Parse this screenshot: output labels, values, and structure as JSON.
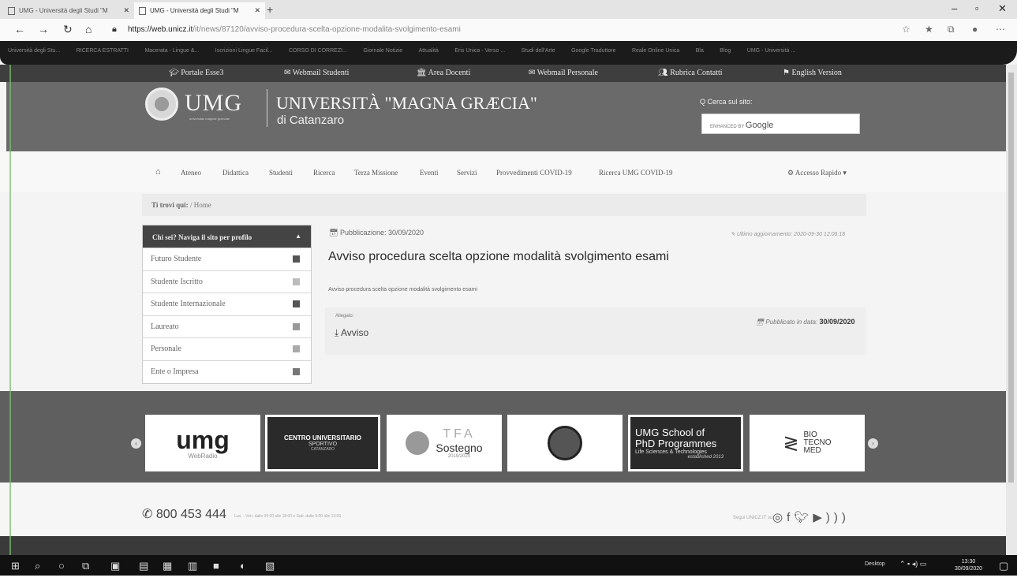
{
  "browser": {
    "tabs": [
      {
        "title": "UMG - Università degli Studi \"M"
      },
      {
        "title": "UMG - Università degli Studi \"M"
      }
    ],
    "new_tab": "+",
    "url_domain": "https://web.unicz.it",
    "url_path": "/it/news/87120/avviso-procedura-scelta-opzione-modalita-svolgimento-esami",
    "bookmarks": [
      "Università degli Stu...",
      "RICERCA ESTRATTI",
      "Macerata - Lingue &...",
      "Iscrizioni Lingue Facil...",
      "CORSO DI CORREZI...",
      "Giornale Notizie",
      "Attualità",
      "Eris Unica - Verso ...",
      "Studi dell'Arte",
      "Google Traduttore",
      "Reale Online Unica",
      "Bla",
      "Blog",
      "UMG - Università ..."
    ]
  },
  "topbar": {
    "items": [
      "Portale Esse3",
      "Webmail Studenti",
      "Area Docenti",
      "Webmail Personale",
      "Rubrica Contatti",
      "English Version"
    ]
  },
  "header": {
    "logo_text": "UMG",
    "logo_subtitle": "universitas magnae graeciae",
    "university_name": "UNIVERSITÀ \"MAGNA GRÆCIA\"",
    "city": "di Catanzaro",
    "search_label": "Q Cerca sul sito:",
    "search_enhanced": "ENHANCED BY",
    "search_brand": "Google"
  },
  "nav": {
    "items": [
      "Ateneo",
      "Didattica",
      "Studenti",
      "Ricerca",
      "Terza Missione",
      "Eventi",
      "Servizi",
      "Provvedimenti COVID-19",
      "Ricerca UMG COVID-19"
    ],
    "quick_access": "Accesso Rapido"
  },
  "breadcrumb": {
    "label": "Ti trovi qui:",
    "home": "Home"
  },
  "sidebar": {
    "title": "Chi sei? Naviga il sito per profilo",
    "items": [
      {
        "label": "Futuro Studente",
        "color": "#555555"
      },
      {
        "label": "Studente Iscritto",
        "color": "#bbbbbb"
      },
      {
        "label": "Studente Internazionale",
        "color": "#555555"
      },
      {
        "label": "Laureato",
        "color": "#999999"
      },
      {
        "label": "Personale",
        "color": "#aaaaaa"
      },
      {
        "label": "Ente o Impresa",
        "color": "#777777"
      }
    ]
  },
  "article": {
    "published_label": "Pubblicazione:",
    "published_date": "30/09/2020",
    "last_update": "Ultimo aggiornamento: 2020-09-30 12:06:18",
    "title": "Avviso procedura scelta opzione modalità svolgimento esami",
    "body": "Avviso procedura scelta opzione modalità svolgimento esami",
    "attachments_label": "Allegato:",
    "attachment_name": "Avviso",
    "attachment_date_label": "Pubblicato in data:",
    "attachment_date": "30/09/2020"
  },
  "banners": {
    "webradio_text": "umg",
    "webradio_sub": "WebRadio",
    "cus_title": "CENTRO UNIVERSITARIO",
    "cus_sub": "SPORTIVO",
    "cus_city": "CATANZARO",
    "tfa_text": "TFA",
    "tfa_title": "Sostegno",
    "tfa_year": "2019/2020",
    "phd_line1": "UMG School of",
    "phd_line2": "PhD Programmes",
    "phd_line3": "Life Sciences & Technologies",
    "phd_line4": "established 2013",
    "bio_line1": "BIO",
    "bio_line2": "TECNO",
    "bio_line3": "MED"
  },
  "footer": {
    "phone": "800 453 444",
    "phone_hours": "Lun. - Ven. dalle 09:00 alle 18:00 e Sab. dalle 9:00 alle 13:00",
    "social_label": "Segui UNICZ.IT su:"
  },
  "taskbar": {
    "desktop_label": "Desktop",
    "time": "13:30",
    "date": "30/09/2020"
  }
}
